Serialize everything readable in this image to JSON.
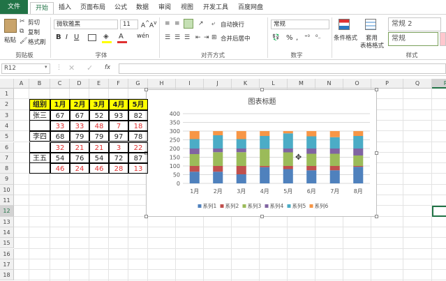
{
  "tabs": [
    "文件",
    "开始",
    "插入",
    "页面布局",
    "公式",
    "数据",
    "审阅",
    "视图",
    "开发工具",
    "百度网盘"
  ],
  "ribbon": {
    "paste": "粘贴",
    "cut": "剪切",
    "copy": "复制",
    "format_painter": "格式刷",
    "clipboard_label": "剪贴板",
    "font_name": "微软雅黑",
    "font_size": "11",
    "font_label": "字体",
    "wrap_text": "自动换行",
    "merge_center": "合并后居中",
    "align_label": "对齐方式",
    "number_format": "常规",
    "number_label": "数字",
    "cond_format": "条件格式",
    "table_format_1": "套用",
    "table_format_2": "表格格式",
    "style_label": "样式",
    "style_normal2": "常规 2",
    "style_normal": "常规"
  },
  "formula_bar": {
    "name_box": "R12",
    "fx": "fx"
  },
  "columns": [
    "A",
    "B",
    "C",
    "D",
    "E",
    "F",
    "G",
    "H",
    "I",
    "J",
    "K",
    "L",
    "M",
    "N",
    "O",
    "P",
    "Q",
    "R"
  ],
  "rows": [
    "1",
    "2",
    "3",
    "4",
    "5",
    "6",
    "7",
    "8",
    "9",
    "10",
    "11",
    "12",
    "13",
    "14",
    "15",
    "16",
    "17",
    "18"
  ],
  "table": {
    "headers": [
      "组别",
      "1月",
      "2月",
      "3月",
      "4月",
      "5月"
    ],
    "rows": [
      {
        "name": "张三",
        "values": [
          "67",
          "67",
          "52",
          "93",
          "82"
        ],
        "red": false
      },
      {
        "name": "",
        "values": [
          "33",
          "33",
          "48",
          "7",
          "18"
        ],
        "red": true
      },
      {
        "name": "李四",
        "values": [
          "68",
          "79",
          "79",
          "97",
          "78"
        ],
        "red": false
      },
      {
        "name": "",
        "values": [
          "32",
          "21",
          "21",
          "3",
          "22"
        ],
        "red": true
      },
      {
        "name": "王五",
        "values": [
          "54",
          "76",
          "54",
          "72",
          "87"
        ],
        "red": false
      },
      {
        "name": "",
        "values": [
          "46",
          "24",
          "46",
          "28",
          "13"
        ],
        "red": true
      }
    ]
  },
  "chart_data": {
    "type": "bar",
    "title": "图表标题",
    "categories": [
      "1月",
      "2月",
      "3月",
      "4月",
      "5月",
      "6月",
      "7月",
      "8月"
    ],
    "ylim": [
      0,
      400
    ],
    "yticks": [
      "0",
      "50",
      "100",
      "150",
      "200",
      "250",
      "300",
      "350",
      "400"
    ],
    "stacked": true,
    "legend": "bottom",
    "series": [
      {
        "name": "系列1",
        "color": "#4f81bd",
        "values": [
          67,
          67,
          52,
          93,
          82,
          75,
          75,
          95
        ]
      },
      {
        "name": "系列2",
        "color": "#c0504d",
        "values": [
          33,
          33,
          48,
          7,
          18,
          25,
          25,
          5
        ]
      },
      {
        "name": "系列3",
        "color": "#9bbb59",
        "values": [
          68,
          79,
          79,
          97,
          78,
          70,
          70,
          60
        ]
      },
      {
        "name": "系列4",
        "color": "#8064a2",
        "values": [
          32,
          21,
          21,
          3,
          22,
          30,
          30,
          40
        ]
      },
      {
        "name": "系列5",
        "color": "#4bacc6",
        "values": [
          54,
          76,
          54,
          72,
          87,
          70,
          65,
          72
        ]
      },
      {
        "name": "系列6",
        "color": "#f79646",
        "values": [
          46,
          24,
          46,
          28,
          13,
          30,
          35,
          28
        ]
      }
    ]
  }
}
